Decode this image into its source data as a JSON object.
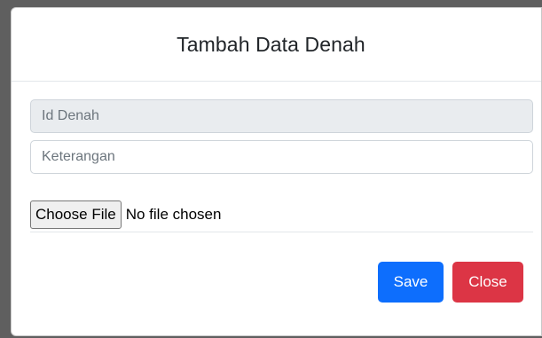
{
  "modal": {
    "title": "Tambah Data Denah"
  },
  "form": {
    "id_denah": {
      "placeholder": "Id Denah",
      "value": ""
    },
    "keterangan": {
      "placeholder": "Keterangan",
      "value": ""
    },
    "file": {
      "button_label": "Choose File",
      "status": "No file chosen"
    }
  },
  "actions": {
    "save_label": "Save",
    "close_label": "Close"
  },
  "colors": {
    "primary": "#0d6efd",
    "danger": "#dc3545",
    "readonly_bg": "#e9ecef"
  }
}
